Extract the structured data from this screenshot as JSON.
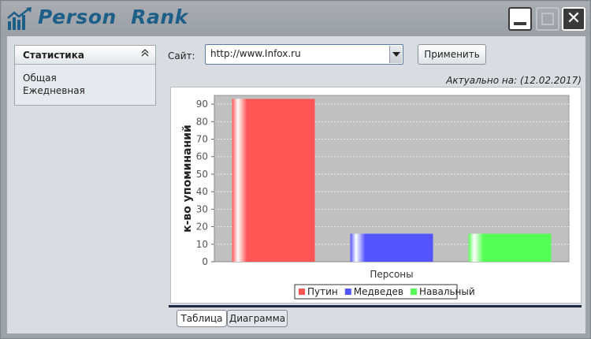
{
  "app": {
    "title": "Person  Rank"
  },
  "window_controls": {
    "close_symbol": "✕"
  },
  "sidebar": {
    "title": "Статистика",
    "collapse_symbol": "⌃",
    "items": [
      {
        "label": "Общая"
      },
      {
        "label": "Ежедневная"
      }
    ]
  },
  "toolbar": {
    "site_label": "Сайт:",
    "site_value": "http://www.Infox.ru",
    "apply_label": "Применить"
  },
  "actual": {
    "text": "Актуально на: (12.02.2017)"
  },
  "tabs": [
    {
      "label": "Таблица"
    },
    {
      "label": "Диаграмма"
    }
  ],
  "chart_data": {
    "type": "bar",
    "xlabel": "Персоны",
    "ylabel": "к-во упоминаний",
    "ylim": [
      0,
      95
    ],
    "yticks": [
      0,
      10,
      20,
      30,
      40,
      50,
      60,
      70,
      80,
      90
    ],
    "grid": true,
    "legend_position": "bottom",
    "series": [
      {
        "name": "Путин",
        "value": 93,
        "color": "#ff5555"
      },
      {
        "name": "Медведев",
        "value": 16,
        "color": "#5555ff"
      },
      {
        "name": "Навальный",
        "value": 16,
        "color": "#55ff55"
      }
    ]
  }
}
